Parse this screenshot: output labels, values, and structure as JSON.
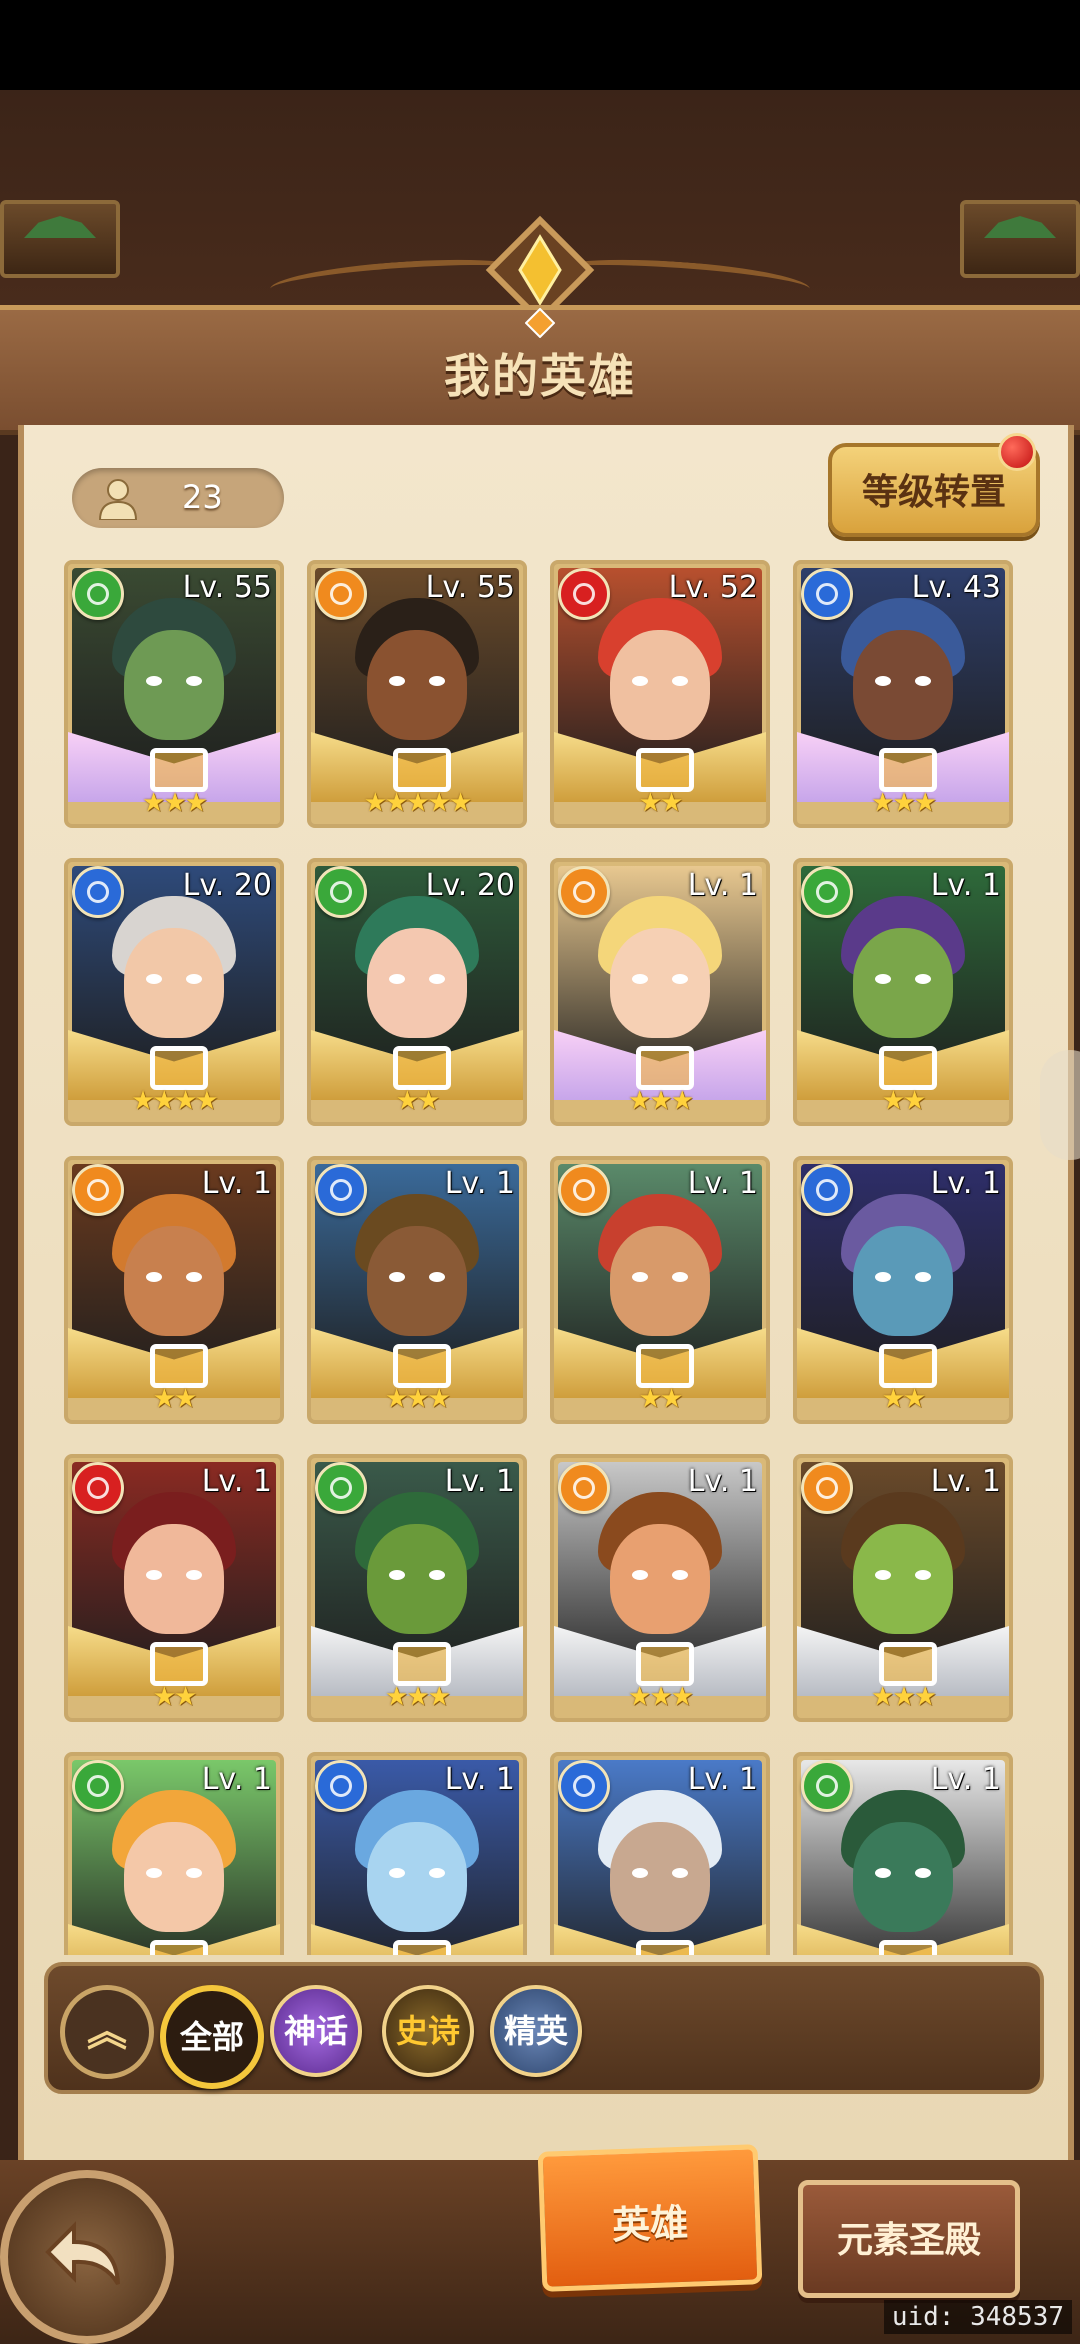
{
  "header": {
    "title": "我的英雄"
  },
  "hero_count": "23",
  "level_transfer_button": "等级转置",
  "heroes": [
    {
      "level": "Lv. 55",
      "stars": "★★★",
      "element": "wind",
      "rarity": "mythic",
      "colors": {
        "skin": "#6e9a54",
        "hair": "#2e4a3e",
        "bg": "#3a4a32"
      }
    },
    {
      "level": "Lv. 55",
      "stars": "★★★★★",
      "element": "fire",
      "rarity": "epic",
      "colors": {
        "skin": "#8a5230",
        "hair": "#2a2018",
        "bg": "#6a4a2a"
      }
    },
    {
      "level": "Lv. 52",
      "stars": "★★",
      "element": "flame",
      "rarity": "epic",
      "colors": {
        "skin": "#f0c0a0",
        "hair": "#d8402e",
        "bg": "#b8502e"
      }
    },
    {
      "level": "Lv. 43",
      "stars": "★★★",
      "element": "water",
      "rarity": "mythic",
      "colors": {
        "skin": "#7a4a34",
        "hair": "#3a5a9a",
        "bg": "#2e3e6a"
      }
    },
    {
      "level": "Lv. 20",
      "stars": "★★★★",
      "element": "water",
      "rarity": "epic",
      "colors": {
        "skin": "#f2c8a8",
        "hair": "#d8d4d0",
        "bg": "#2e4a7a"
      }
    },
    {
      "level": "Lv. 20",
      "stars": "★★",
      "element": "wind",
      "rarity": "epic",
      "colors": {
        "skin": "#f4c8b0",
        "hair": "#2e7a5a",
        "bg": "#2e5a3a"
      }
    },
    {
      "level": "Lv. 1",
      "stars": "★★★",
      "element": "fire",
      "rarity": "mythic",
      "colors": {
        "skin": "#f6d0b4",
        "hair": "#f4d67a",
        "bg": "#e8c890"
      }
    },
    {
      "level": "Lv. 1",
      "stars": "★★",
      "element": "wind",
      "rarity": "epic",
      "colors": {
        "skin": "#7aa64a",
        "hair": "#5a3a8a",
        "bg": "#2e6a3a"
      }
    },
    {
      "level": "Lv. 1",
      "stars": "★★",
      "element": "fire",
      "rarity": "epic",
      "colors": {
        "skin": "#c8804e",
        "hair": "#d27a2e",
        "bg": "#6a3a1e"
      }
    },
    {
      "level": "Lv. 1",
      "stars": "★★★",
      "element": "water",
      "rarity": "epic",
      "colors": {
        "skin": "#8a5a36",
        "hair": "#6a4a20",
        "bg": "#3a6a9a"
      }
    },
    {
      "level": "Lv. 1",
      "stars": "★★",
      "element": "fire",
      "rarity": "epic",
      "colors": {
        "skin": "#d89a6a",
        "hair": "#c8402e",
        "bg": "#5a8a6a"
      }
    },
    {
      "level": "Lv. 1",
      "stars": "★★",
      "element": "water",
      "rarity": "epic",
      "colors": {
        "skin": "#5a9ab8",
        "hair": "#6a5aa0",
        "bg": "#2e2e6a"
      }
    },
    {
      "level": "Lv. 1",
      "stars": "★★",
      "element": "flame",
      "rarity": "epic",
      "colors": {
        "skin": "#f0b89a",
        "hair": "#7a1e1e",
        "bg": "#8a2a22"
      }
    },
    {
      "level": "Lv. 1",
      "stars": "★★★",
      "element": "wind",
      "rarity": "elite",
      "colors": {
        "skin": "#6a9a3a",
        "hair": "#2e6a3a",
        "bg": "#3a5a4a"
      }
    },
    {
      "level": "Lv. 1",
      "stars": "★★★",
      "element": "fire",
      "rarity": "elite",
      "colors": {
        "skin": "#e8a070",
        "hair": "#8a4a1e",
        "bg": "#c8c8c8"
      }
    },
    {
      "level": "Lv. 1",
      "stars": "★★★",
      "element": "fire",
      "rarity": "elite",
      "colors": {
        "skin": "#8ab84a",
        "hair": "#5a3a1e",
        "bg": "#6a4a2a"
      }
    },
    {
      "level": "Lv. 1",
      "stars": "",
      "element": "wind",
      "rarity": "epic",
      "colors": {
        "skin": "#f4c8a8",
        "hair": "#f2a63a",
        "bg": "#7ac86a"
      }
    },
    {
      "level": "Lv. 1",
      "stars": "",
      "element": "water",
      "rarity": "epic",
      "colors": {
        "skin": "#a8d4f0",
        "hair": "#6aa8e0",
        "bg": "#3a5aa8"
      }
    },
    {
      "level": "Lv. 1",
      "stars": "",
      "element": "water",
      "rarity": "epic",
      "colors": {
        "skin": "#c8a890",
        "hair": "#e4ecf4",
        "bg": "#4a7ac8"
      }
    },
    {
      "level": "Lv. 1",
      "stars": "",
      "element": "wind",
      "rarity": "epic",
      "colors": {
        "skin": "#3a7a5a",
        "hair": "#2a5a3a",
        "bg": "#e8e8e8"
      }
    }
  ],
  "element_colors": {
    "wind": "#3aa83a",
    "fire": "#f08a1e",
    "flame": "#d82020",
    "water": "#2a6ad8"
  },
  "filters": {
    "all": "全部",
    "myth": "神话",
    "epic": "史诗",
    "elite": "精英"
  },
  "tabs": {
    "hero": "英雄",
    "element_temple": "元素圣殿"
  },
  "uid": "uid: 348537"
}
